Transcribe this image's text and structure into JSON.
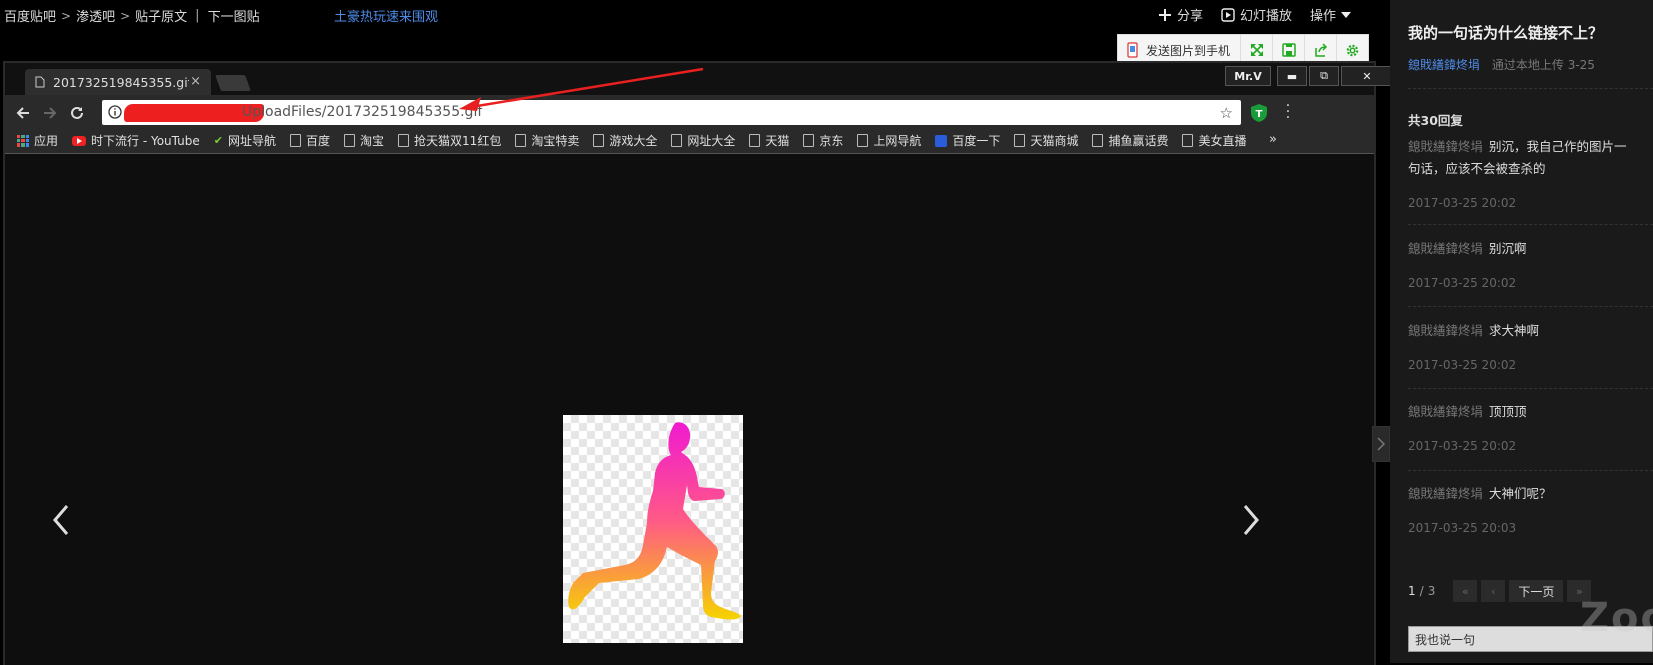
{
  "crumbs": {
    "items": [
      "百度贴吧",
      "渗透吧",
      "贴子原文"
    ],
    "next": "下一图贴"
  },
  "promo": "土豪热玩速来围观",
  "top_actions": {
    "share": "分享",
    "slideshow": "幻灯播放",
    "operate": "操作"
  },
  "image_tools": {
    "send_to_phone": "发送图片到手机"
  },
  "browser": {
    "tab_title": "201732519845355.gif (",
    "tab_close": "×",
    "profile": "Mr.V",
    "url_visible": "UploadFiles/201732519845355.gif",
    "bookmarks": [
      {
        "label": "应用",
        "icon": "apps-grid-icon"
      },
      {
        "label": "时下流行 - YouTube",
        "icon": "youtube-icon"
      },
      {
        "label": "网址导航",
        "icon": "hao-icon"
      },
      {
        "label": "百度",
        "icon": "page-icon"
      },
      {
        "label": "淘宝",
        "icon": "page-icon"
      },
      {
        "label": "抢天猫双11红包",
        "icon": "page-icon"
      },
      {
        "label": "淘宝特卖",
        "icon": "page-icon"
      },
      {
        "label": "游戏大全",
        "icon": "page-icon"
      },
      {
        "label": "网址大全",
        "icon": "page-icon"
      },
      {
        "label": "天猫",
        "icon": "page-icon"
      },
      {
        "label": "京东",
        "icon": "page-icon"
      },
      {
        "label": "上网导航",
        "icon": "page-icon"
      },
      {
        "label": "百度一下",
        "icon": "baidu-paw-icon"
      },
      {
        "label": "天猫商城",
        "icon": "page-icon"
      },
      {
        "label": "捕鱼赢话费",
        "icon": "page-icon"
      },
      {
        "label": "美女直播",
        "icon": "page-icon"
      }
    ],
    "more": "»"
  },
  "post": {
    "title": "我的一句话为什么链接不上？",
    "author": "鎴戝繕鍏炵埍",
    "upload_info": "通过本地上传",
    "date": "3-25"
  },
  "replies_header": "共30回复",
  "replies": [
    {
      "user": "鎴戝繕鍏炵埍",
      "text": "别沉，我自己作的图片一句话，应该不会被查杀的",
      "time": "2017-03-25 20:02"
    },
    {
      "user": "鎴戝繕鍏炵埍",
      "text": "别沉啊",
      "time": "2017-03-25 20:02"
    },
    {
      "user": "鎴戝繕鍏炵埍",
      "text": "求大神啊",
      "time": "2017-03-25 20:02"
    },
    {
      "user": "鎴戝繕鍏炵埍",
      "text": "顶顶顶",
      "time": "2017-03-25 20:02"
    },
    {
      "user": "鎴戝繕鍏炵埍",
      "text": "大神们呢？",
      "time": "2017-03-25 20:03"
    }
  ],
  "pager": {
    "current": "1",
    "total": "3",
    "next": "下一页"
  },
  "comment_placeholder": "我也说一句",
  "watermark": "ZooS",
  "colors": {
    "link": "#4e8be8",
    "background": "#000000",
    "panel": "#1a1a1a",
    "redaction": "#ee1f1f"
  }
}
